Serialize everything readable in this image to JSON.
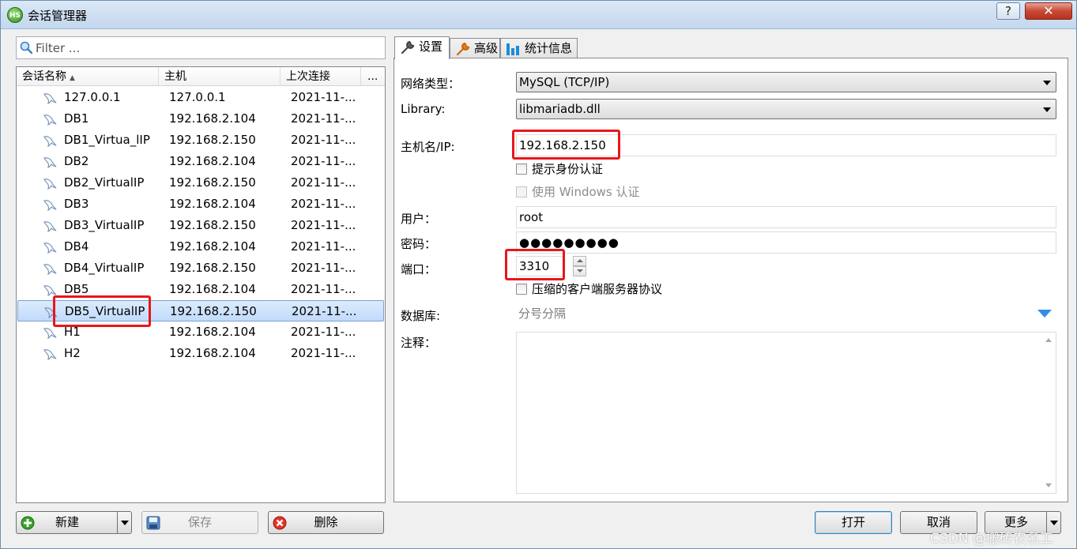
{
  "window": {
    "title": "会话管理器",
    "app_icon_text": "HS",
    "help_label": "?",
    "close_label": "✕"
  },
  "filter": {
    "placeholder": "Filter ..."
  },
  "list": {
    "columns": {
      "name": "会话名称",
      "host": "主机",
      "last": "上次连接",
      "more": "..."
    },
    "sort_indicator": "▲",
    "rows": [
      {
        "name": "127.0.0.1",
        "host": "127.0.0.1",
        "last": "2021-11-..."
      },
      {
        "name": "DB1",
        "host": "192.168.2.104",
        "last": "2021-11-..."
      },
      {
        "name": "DB1_Virtua_lIP",
        "host": "192.168.2.150",
        "last": "2021-11-..."
      },
      {
        "name": "DB2",
        "host": "192.168.2.104",
        "last": "2021-11-..."
      },
      {
        "name": "DB2_VirtualIP",
        "host": "192.168.2.150",
        "last": "2021-11-..."
      },
      {
        "name": "DB3",
        "host": "192.168.2.104",
        "last": "2021-11-..."
      },
      {
        "name": "DB3_VirtualIP",
        "host": "192.168.2.150",
        "last": "2021-11-..."
      },
      {
        "name": "DB4",
        "host": "192.168.2.104",
        "last": "2021-11-..."
      },
      {
        "name": "DB4_VirtualIP",
        "host": "192.168.2.150",
        "last": "2021-11-..."
      },
      {
        "name": "DB5",
        "host": "192.168.2.104",
        "last": "2021-11-..."
      },
      {
        "name": "DB5_VirtualIP",
        "host": "192.168.2.150",
        "last": "2021-11-...",
        "selected": true
      },
      {
        "name": "H1",
        "host": "192.168.2.104",
        "last": "2021-11-..."
      },
      {
        "name": "H2",
        "host": "192.168.2.104",
        "last": "2021-11-..."
      }
    ]
  },
  "left_buttons": {
    "new": "新建",
    "save": "保存",
    "delete": "删除"
  },
  "tabs": {
    "settings": "设置",
    "advanced": "高级",
    "stats": "统计信息"
  },
  "settings": {
    "network_type_label": "网络类型：",
    "network_type_value": "MySQL (TCP/IP)",
    "library_label": "Library:",
    "library_value": "libmariadb.dll",
    "host_label": "主机名/IP:",
    "host_value": "192.168.2.150",
    "prompt_auth_label": "提示身份认证",
    "windows_auth_label": "使用 Windows 认证",
    "user_label": "用户：",
    "user_value": "root",
    "password_label": "密码：",
    "password_value": "●●●●●●●●●",
    "port_label": "端口：",
    "port_value": "3310",
    "compress_label": "压缩的客户端服务器协议",
    "database_label": "数据库:",
    "database_placeholder": "分号分隔",
    "notes_label": "注释："
  },
  "bottom_buttons": {
    "open": "打开",
    "cancel": "取消",
    "more": "更多"
  },
  "watermark": "CSDN @搬砖农名工",
  "colors": {
    "highlight": "#e8161c",
    "selection": "#c1dbfc",
    "accent_arrow": "#2f8fe3"
  }
}
